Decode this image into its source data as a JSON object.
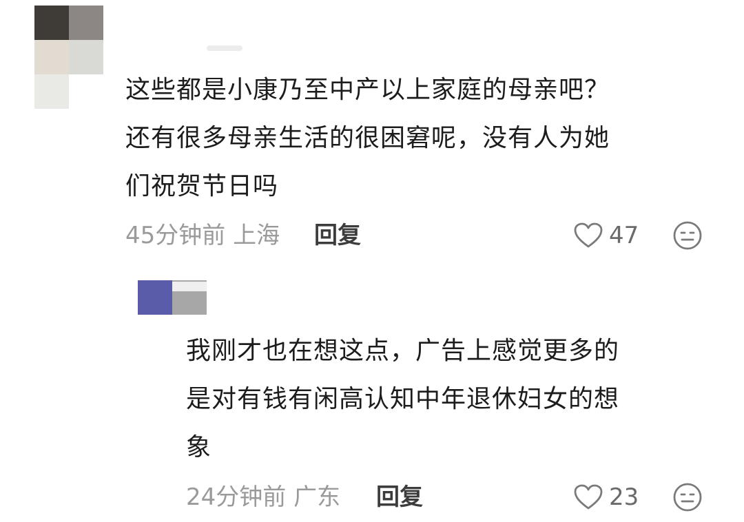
{
  "comments": [
    {
      "avatar_pixels": [
        "#3f3c37",
        "#8c8685",
        "#e2dbd1",
        "#d9d9d5",
        "#e9e9e6",
        "#ffffff"
      ],
      "text_lines": [
        "这些都是小康乃至中产以上家庭的母亲吧？",
        "还有很多母亲生活的很困窘呢，没有人为她",
        "们祝贺节日吗"
      ],
      "time_location": "45分钟前 上海",
      "reply_label": "回复",
      "like_count": "47",
      "like_icon": "heart-outline-icon",
      "emoji_icon": "smiley-face-icon"
    },
    {
      "avatar_pixels": [
        "#5a5caa",
        "#a7a7a7"
      ],
      "text_lines": [
        "我刚才也在想这点，广告上感觉更多的",
        "是对有钱有闲高认知中年退休妇女的想",
        "象"
      ],
      "time_location": "24分钟前 广东",
      "reply_label": "回复",
      "like_count": "23",
      "like_icon": "heart-outline-icon",
      "emoji_icon": "smiley-face-icon"
    }
  ],
  "colors": {
    "meta_text": "#9a9a9a",
    "reply_text": "#3c3c3c",
    "body_text": "#1c1c1c",
    "icon_stroke": "#7a7a7a"
  }
}
